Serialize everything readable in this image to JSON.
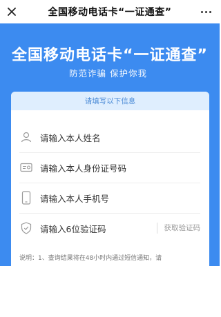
{
  "titlebar": {
    "title": "全国移动电话卡“一证通查”",
    "close_icon": "close-icon",
    "more_icon": "more-icon"
  },
  "hero": {
    "title": "全国移动电话卡“一证通查”",
    "subtitle": "防范诈骗 保护你我"
  },
  "form": {
    "header": "请填写以下信息",
    "name_placeholder": "请输入本人姓名",
    "id_placeholder": "请输入本人身份证号码",
    "phone_placeholder": "请输入本人手机号",
    "code_placeholder": "请输入6位验证码",
    "get_code_label": "获取验证码",
    "note": "说明：1、查询结果将在48小时内通过短信通知，请"
  },
  "colors": {
    "brand": "#3c8bf0",
    "header_bg": "#dfeefe",
    "header_text": "#4a8ad6"
  }
}
